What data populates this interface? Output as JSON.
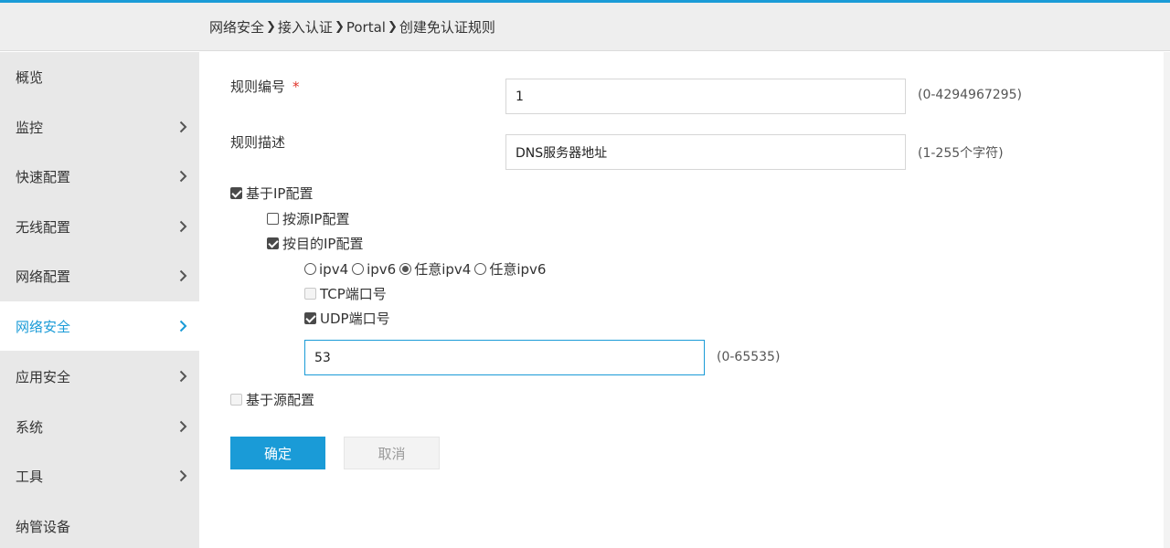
{
  "colors": {
    "accent": "#1a9bd7",
    "required": "#e0342a",
    "sidebar_bg": "#e8e8e8",
    "header_bg": "#eeeeee"
  },
  "breadcrumb": [
    "网络安全",
    "接入认证",
    "Portal",
    "创建免认证规则"
  ],
  "sidebar": {
    "items": [
      {
        "label": "概览",
        "has_chevron": false
      },
      {
        "label": "监控",
        "has_chevron": true
      },
      {
        "label": "快速配置",
        "has_chevron": true
      },
      {
        "label": "无线配置",
        "has_chevron": true
      },
      {
        "label": "网络配置",
        "has_chevron": true
      },
      {
        "label": "网络安全",
        "has_chevron": true,
        "active": true
      },
      {
        "label": "应用安全",
        "has_chevron": true
      },
      {
        "label": "系统",
        "has_chevron": true
      },
      {
        "label": "工具",
        "has_chevron": true
      },
      {
        "label": "纳管设备",
        "has_chevron": false
      }
    ]
  },
  "form": {
    "rule_id": {
      "label": "规则编号",
      "required_mark": "*",
      "value": "1",
      "hint": "(0-4294967295)"
    },
    "rule_desc": {
      "label": "规则描述",
      "value": "DNS服务器地址",
      "hint": "(1-255个字符)"
    },
    "ip_based": {
      "label": "基于IP配置",
      "checked": true
    },
    "by_src_ip": {
      "label": "按源IP配置",
      "checked": false
    },
    "by_dst_ip": {
      "label": "按目的IP配置",
      "checked": true
    },
    "ip_type_options": [
      {
        "label": "ipv4",
        "selected": false
      },
      {
        "label": "ipv6",
        "selected": false
      },
      {
        "label": "任意ipv4",
        "selected": true
      },
      {
        "label": "任意ipv6",
        "selected": false
      }
    ],
    "tcp_port": {
      "label": "TCP端口号",
      "checked": false,
      "disabled": true
    },
    "udp_port": {
      "label": "UDP端口号",
      "checked": true
    },
    "udp_port_value": {
      "value": "53",
      "hint": "(0-65535)"
    },
    "source_based": {
      "label": "基于源配置",
      "checked": false,
      "disabled": true
    }
  },
  "buttons": {
    "confirm": "确定",
    "cancel": "取消"
  }
}
